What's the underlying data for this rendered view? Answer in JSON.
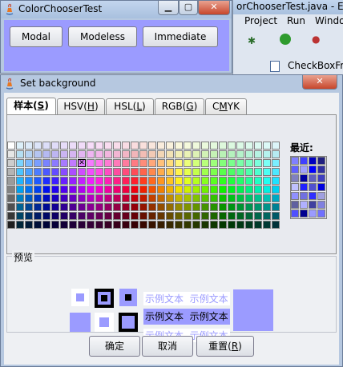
{
  "main_window": {
    "title": "ColorChooserTest",
    "buttons": [
      "Modal",
      "Modeless",
      "Immediate"
    ],
    "bg_color": "#9b9bff"
  },
  "eclipse": {
    "title": "orChooserTest.java - Ecl",
    "menu": [
      "Project",
      "Run",
      "Windo"
    ],
    "tab_label": "CheckBoxFr"
  },
  "dialog": {
    "title": "Set background",
    "tabs": [
      {
        "label": "样本(",
        "mn": "S",
        "end": ")"
      },
      {
        "label": "HSV(",
        "mn": "H",
        "end": ")"
      },
      {
        "label": "HSL(",
        "mn": "L",
        "end": ")"
      },
      {
        "label": "RGB(",
        "mn": "G",
        "end": ")"
      },
      {
        "label": "C",
        "mn": "M",
        "end": "YK"
      }
    ],
    "recent_label": "最近:",
    "preview_label": "预览",
    "sample_text": "示例文本",
    "buttons": {
      "ok": "确定",
      "cancel": "取消",
      "reset": "重置(",
      "reset_mn": "R",
      "reset_end": ")"
    },
    "selected_color": "#9b9bff"
  },
  "icons": [
    "java-icon",
    "minimize-icon",
    "maximize-icon",
    "close-icon"
  ]
}
